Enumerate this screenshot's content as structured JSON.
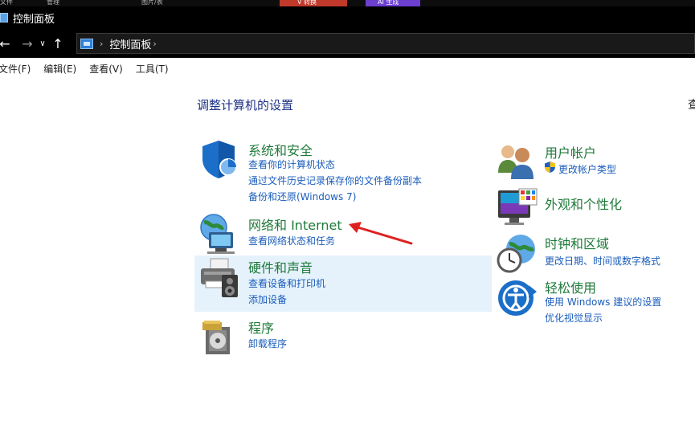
{
  "window": {
    "title": "控制面板",
    "taskbar_fragments": [
      "文件",
      "管理",
      "图片/表",
      "V 转换",
      "AI 生成"
    ]
  },
  "navigation": {
    "back_icon": "arrow-left-icon",
    "forward_icon": "arrow-right-icon",
    "recent_icon": "chevron-down-icon",
    "up_icon": "arrow-up-icon",
    "address_icon": "control-panel-icon",
    "breadcrumb_separator": "›",
    "breadcrumb": "控制面板"
  },
  "menu": [
    "文件(F)",
    "编辑(E)",
    "查看(V)",
    "工具(T)"
  ],
  "main": {
    "heading": "调整计算机的设置",
    "view_by_cut": "查",
    "left_categories": [
      {
        "title": "系统和安全",
        "icon": "shield-icon",
        "links": [
          "查看你的计算机状态",
          "通过文件历史记录保存你的文件备份副本",
          "备份和还原(Windows 7)"
        ]
      },
      {
        "title": "网络和 Internet",
        "icon": "network-globe-icon",
        "links": [
          "查看网络状态和任务"
        ]
      },
      {
        "title": "硬件和声音",
        "icon": "printer-speaker-icon",
        "links": [
          "查看设备和打印机",
          "添加设备"
        ]
      },
      {
        "title": "程序",
        "icon": "programs-disc-icon",
        "links": [
          "卸载程序"
        ]
      }
    ],
    "right_categories": [
      {
        "title": "用户帐户",
        "icon": "users-icon",
        "links": [
          "更改帐户类型"
        ]
      },
      {
        "title": "外观和个性化",
        "icon": "monitor-palette-icon",
        "links": []
      },
      {
        "title": "时钟和区域",
        "icon": "clock-globe-icon",
        "links": [
          "更改日期、时间或数字格式"
        ]
      },
      {
        "title": "轻松使用",
        "icon": "ease-of-access-icon",
        "links": [
          "使用 Windows 建议的设置",
          "优化视觉显示"
        ]
      }
    ]
  },
  "colors": {
    "category_title": "#1f7a3a",
    "link": "#1b5dbb",
    "heading": "#1e3287",
    "hover_highlight": "#e5f2fc",
    "annotation_arrow": "#e02020"
  }
}
